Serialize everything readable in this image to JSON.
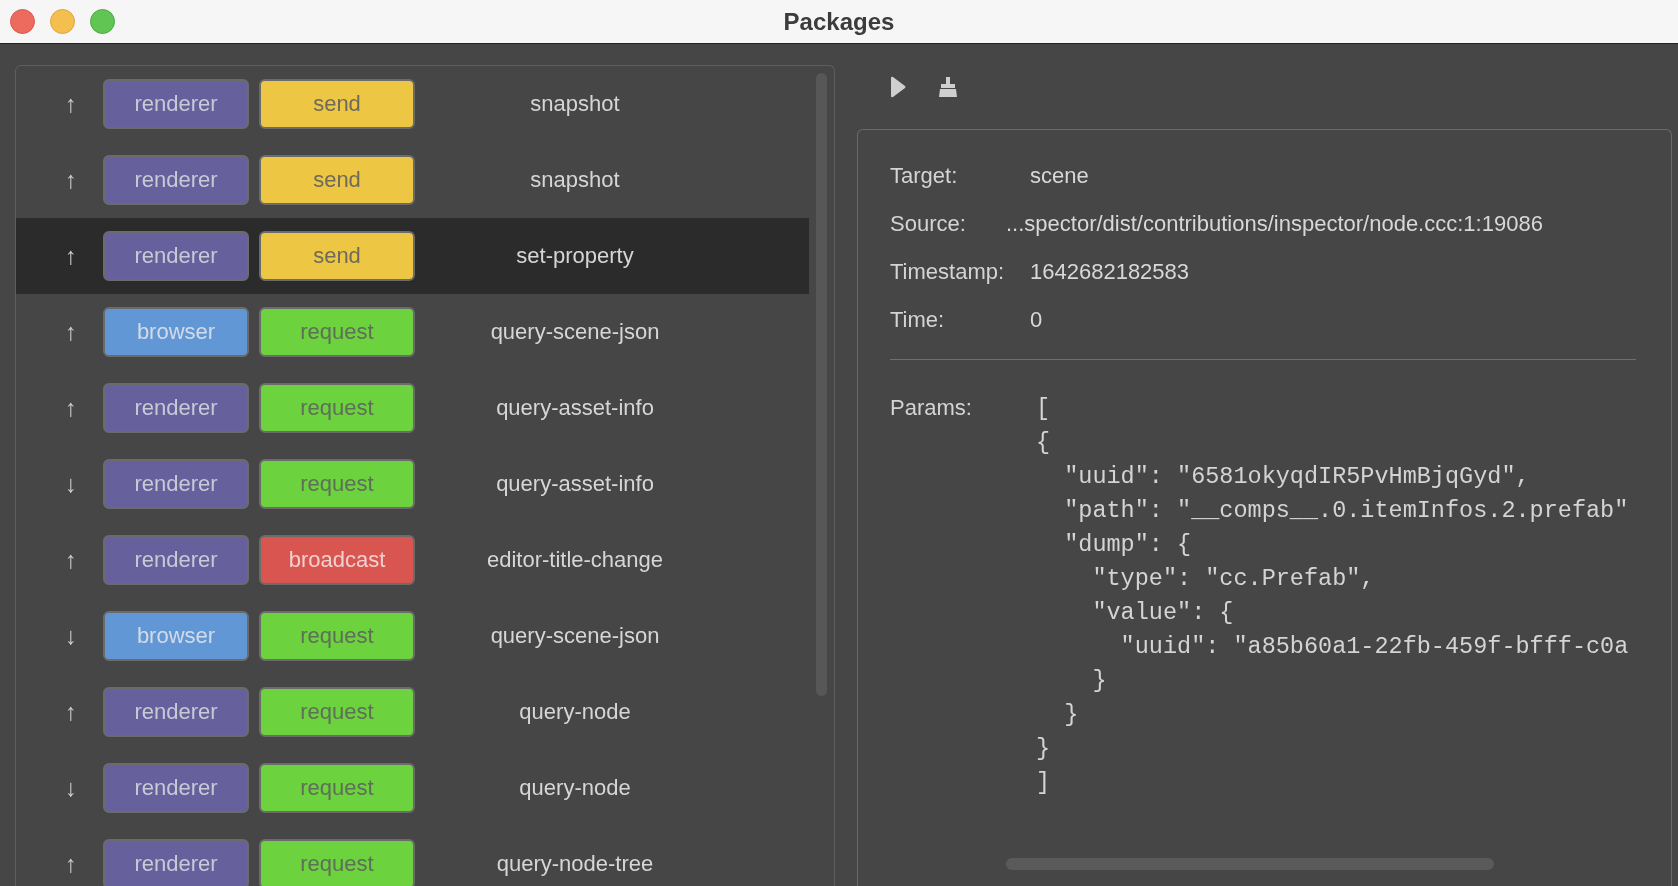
{
  "window": {
    "title": "Packages"
  },
  "messages": [
    {
      "direction": "↑",
      "process": {
        "text": "renderer",
        "kind": "renderer"
      },
      "type": {
        "text": "send",
        "kind": "send"
      },
      "name": "snapshot",
      "selected": false
    },
    {
      "direction": "↑",
      "process": {
        "text": "renderer",
        "kind": "renderer"
      },
      "type": {
        "text": "send",
        "kind": "send"
      },
      "name": "snapshot",
      "selected": false
    },
    {
      "direction": "↑",
      "process": {
        "text": "renderer",
        "kind": "renderer"
      },
      "type": {
        "text": "send",
        "kind": "send"
      },
      "name": "set-property",
      "selected": true
    },
    {
      "direction": "↑",
      "process": {
        "text": "browser",
        "kind": "browser"
      },
      "type": {
        "text": "request",
        "kind": "request"
      },
      "name": "query-scene-json",
      "selected": false
    },
    {
      "direction": "↑",
      "process": {
        "text": "renderer",
        "kind": "renderer"
      },
      "type": {
        "text": "request",
        "kind": "request"
      },
      "name": "query-asset-info",
      "selected": false
    },
    {
      "direction": "↓",
      "process": {
        "text": "renderer",
        "kind": "renderer"
      },
      "type": {
        "text": "request",
        "kind": "request"
      },
      "name": "query-asset-info",
      "selected": false
    },
    {
      "direction": "↑",
      "process": {
        "text": "renderer",
        "kind": "renderer"
      },
      "type": {
        "text": "broadcast",
        "kind": "broadcast"
      },
      "name": "editor-title-change",
      "selected": false
    },
    {
      "direction": "↓",
      "process": {
        "text": "browser",
        "kind": "browser"
      },
      "type": {
        "text": "request",
        "kind": "request"
      },
      "name": "query-scene-json",
      "selected": false
    },
    {
      "direction": "↑",
      "process": {
        "text": "renderer",
        "kind": "renderer"
      },
      "type": {
        "text": "request",
        "kind": "request"
      },
      "name": "query-node",
      "selected": false
    },
    {
      "direction": "↓",
      "process": {
        "text": "renderer",
        "kind": "renderer"
      },
      "type": {
        "text": "request",
        "kind": "request"
      },
      "name": "query-node",
      "selected": false
    },
    {
      "direction": "↑",
      "process": {
        "text": "renderer",
        "kind": "renderer"
      },
      "type": {
        "text": "request",
        "kind": "request"
      },
      "name": "query-node-tree",
      "selected": false
    }
  ],
  "details": {
    "fields": [
      {
        "label": "Target:",
        "value": "scene"
      },
      {
        "label": "Source:",
        "value": "...spector/dist/contributions/inspector/node.ccc:1:19086"
      },
      {
        "label": "Timestamp:",
        "value": "1642682182583"
      },
      {
        "label": "Time:",
        "value": "0"
      }
    ],
    "params": {
      "label": "Params:",
      "lines": [
        "[",
        "{",
        "  \"uuid\": \"6581okyqdIR5PvHmBjqGyd\",",
        "  \"path\": \"__comps__.0.itemInfos.2.prefab\"",
        "  \"dump\": {",
        "    \"type\": \"cc.Prefab\",",
        "    \"value\": {",
        "      \"uuid\": \"a85b60a1-22fb-459f-bfff-c0a",
        "    }",
        "  }",
        "}",
        "]"
      ]
    }
  }
}
